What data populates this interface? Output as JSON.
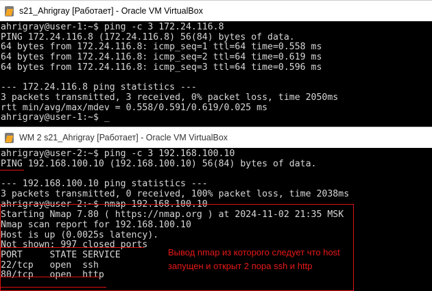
{
  "window1": {
    "title": "s21_Ahrigray [Работает] - Oracle VM VirtualBox",
    "lines": [
      "ahrigray@user-1:~$ ping -c 3 172.24.116.8",
      "PING 172.24.116.8 (172.24.116.8) 56(84) bytes of data.",
      "64 bytes from 172.24.116.8: icmp_seq=1 ttl=64 time=0.558 ms",
      "64 bytes from 172.24.116.8: icmp_seq=2 ttl=64 time=0.619 ms",
      "64 bytes from 172.24.116.8: icmp_seq=3 ttl=64 time=0.596 ms",
      "",
      "--- 172.24.116.8 ping statistics ---",
      "3 packets transmitted, 3 received, 0% packet loss, time 2050ms",
      "rtt min/avg/max/mdev = 0.558/0.591/0.619/0.025 ms",
      "ahrigray@user-1:~$ _"
    ]
  },
  "window2": {
    "title": "WM 2 s21_Ahrigray [Работает] - Oracle VM VirtualBox",
    "lines": [
      "ahrigray@user-2:~$ ping -c 3 192.168.100.10",
      "PING 192.168.100.10 (192.168.100.10) 56(84) bytes of data.",
      "",
      "--- 192.168.100.10 ping statistics ---",
      "3 packets transmitted, 0 received, 100% packet loss, time 2038ms",
      "ahrigray@user-2:~$ nmap 192.168.100.10",
      "Starting Nmap 7.80 ( https://nmap.org ) at 2024-11-02 21:35 MSK",
      "Nmap scan report for 192.168.100.10",
      "Host is up (0.0025s latency).",
      "Not shown: 997 closed ports",
      "PORT     STATE SERVICE",
      "22/tcp   open  ssh",
      "80/tcp   open  http"
    ]
  },
  "annotation": {
    "line1": "Вывод nmap из которого следует что host",
    "line2": "запущен и открыт 2 пора ssh и http",
    "color": "#e01010"
  }
}
